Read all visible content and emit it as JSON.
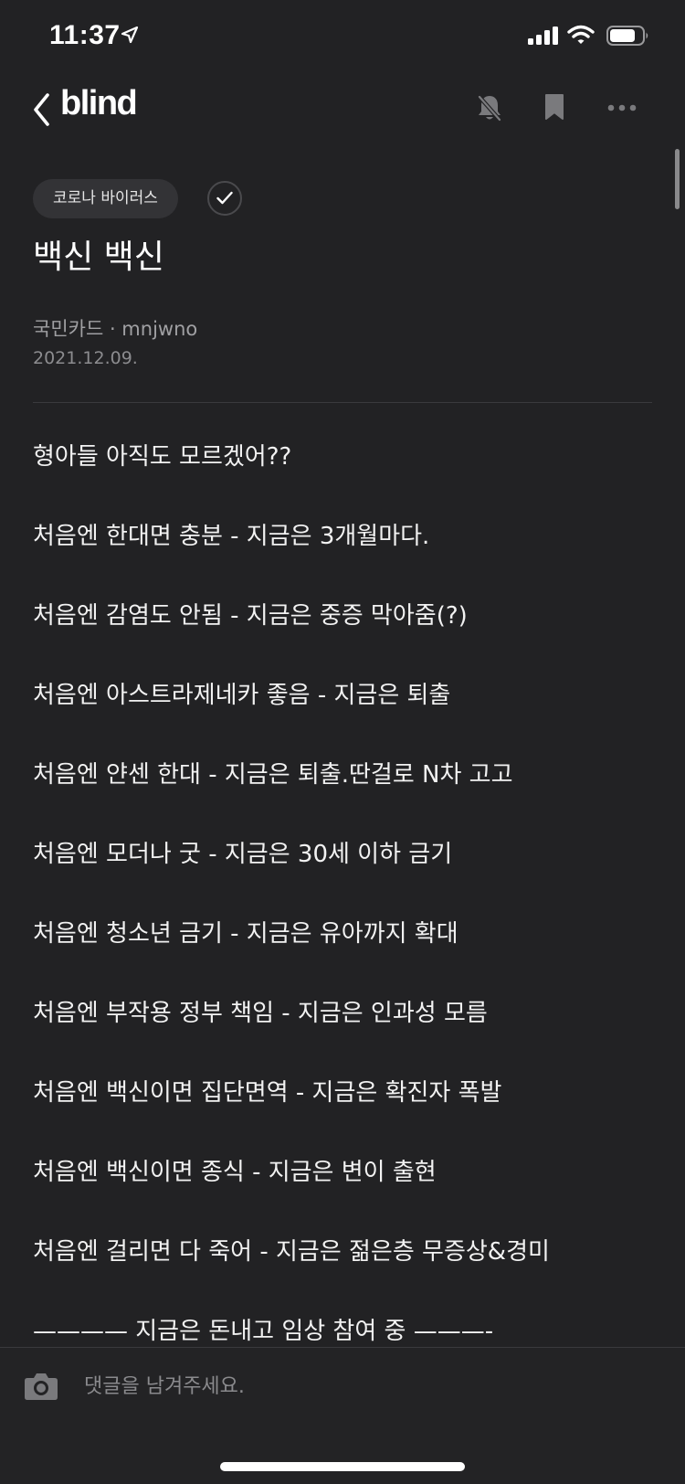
{
  "status_bar": {
    "time": "11:37"
  },
  "nav": {
    "brand": "blind"
  },
  "post": {
    "tag": "코로나 바이러스",
    "title": "백신 백신",
    "author": "국민카드 · mnjwno",
    "date": "2021.12.09.",
    "lines": [
      "형아들 아직도 모르겠어??",
      "처음엔 한대면 충분 - 지금은 3개월마다.",
      "처음엔 감염도 안됨 - 지금은 중증 막아줌(?)",
      "처음엔 아스트라제네카 좋음 - 지금은 퇴출",
      "처음엔 얀센 한대 - 지금은 퇴출.딴걸로 N차 고고",
      "처음엔 모더나 굿 - 지금은 30세 이하 금기",
      "처음엔 청소년 금기 - 지금은 유아까지 확대",
      "처음엔 부작용 정부 책임 - 지금은 인과성 모름",
      "처음엔 백신이면 집단면역 - 지금은 확진자 폭발",
      "처음엔 백신이면 종식 - 지금은 변이 출현",
      "처음엔 걸리면 다 죽어 - 지금은 젊은층 무증상&경미",
      "———— 지금은 돈내고 임상 참여 중 ———-"
    ]
  },
  "comment": {
    "placeholder": "댓글을 남겨주세요."
  },
  "icons": {
    "back": "chevron-left-icon",
    "notification": "bell-off-icon",
    "bookmark": "bookmark-icon",
    "more": "more-horizontal-icon",
    "verified": "check-icon",
    "camera": "camera-icon"
  }
}
